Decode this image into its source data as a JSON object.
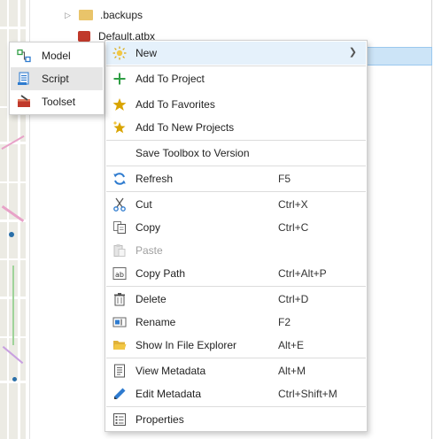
{
  "tree": {
    "items": [
      {
        "label": ".backups"
      },
      {
        "label": "Default.atbx"
      }
    ]
  },
  "context_menu": {
    "items": [
      {
        "label": "New",
        "shortcut": "",
        "icon": "sun-new-icon",
        "has_submenu": true
      },
      {
        "label": "Add To Project",
        "shortcut": "",
        "icon": "plus-icon"
      },
      {
        "label": "Add To Favorites",
        "shortcut": "",
        "icon": "star-icon"
      },
      {
        "label": "Add To New Projects",
        "shortcut": "",
        "icon": "star-sparkle-icon"
      },
      {
        "label": "Save Toolbox to Version",
        "shortcut": "",
        "icon": ""
      },
      {
        "label": "Refresh",
        "shortcut": "F5",
        "icon": "refresh-icon"
      },
      {
        "label": "Cut",
        "shortcut": "Ctrl+X",
        "icon": "scissors-icon"
      },
      {
        "label": "Copy",
        "shortcut": "Ctrl+C",
        "icon": "copy-icon"
      },
      {
        "label": "Paste",
        "shortcut": "",
        "icon": "paste-icon",
        "disabled": true
      },
      {
        "label": "Copy Path",
        "shortcut": "Ctrl+Alt+P",
        "icon": "copy-path-icon"
      },
      {
        "label": "Delete",
        "shortcut": "Ctrl+D",
        "icon": "trash-icon"
      },
      {
        "label": "Rename",
        "shortcut": "F2",
        "icon": "rename-icon"
      },
      {
        "label": "Show In File Explorer",
        "shortcut": "Alt+E",
        "icon": "folder-open-icon"
      },
      {
        "label": "View Metadata",
        "shortcut": "Alt+M",
        "icon": "metadata-view-icon"
      },
      {
        "label": "Edit Metadata",
        "shortcut": "Ctrl+Shift+M",
        "icon": "pencil-icon"
      },
      {
        "label": "Properties",
        "shortcut": "",
        "icon": "properties-icon"
      }
    ]
  },
  "submenu": {
    "items": [
      {
        "label": "Model",
        "icon": "model-icon"
      },
      {
        "label": "Script",
        "icon": "script-icon"
      },
      {
        "label": "Toolset",
        "icon": "toolset-icon"
      }
    ]
  },
  "colors": {
    "highlight": "#e5f1fb",
    "submenu_highlight": "#e6e6e6",
    "accent_blue": "#2e7bcf",
    "star_gold": "#d9a400",
    "plus_green": "#2f9e44"
  }
}
